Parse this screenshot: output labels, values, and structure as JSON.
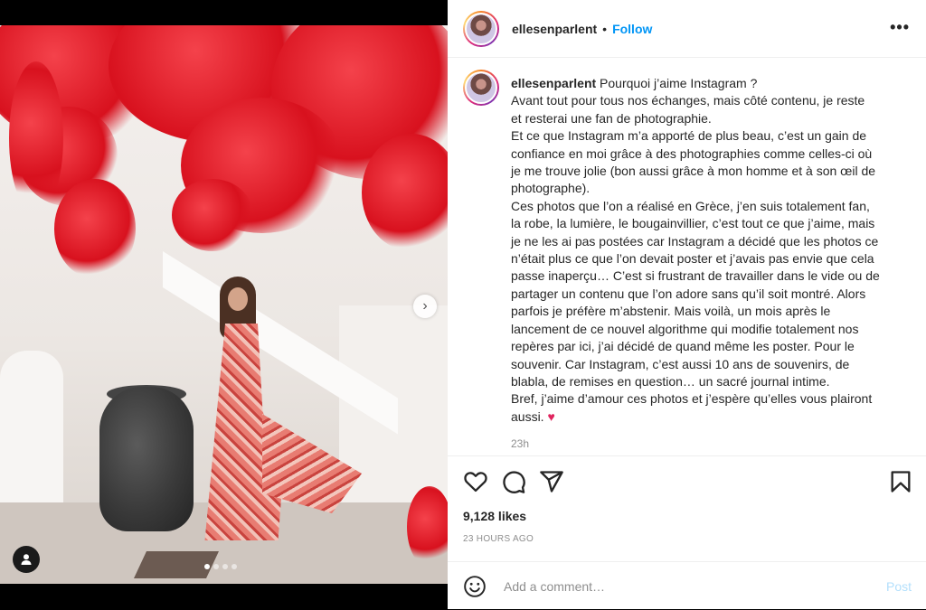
{
  "post": {
    "username": "ellesenparlent",
    "separator": "•",
    "follow_label": "Follow",
    "more_label": "•••",
    "caption_lines": [
      "Avant tout pour tous nos échanges, mais côté contenu, je reste",
      "et resterai une fan de photographie.",
      "Et ce que Instagram m’a apporté de plus beau, c’est un gain de",
      "confiance en moi grâce à des photographies comme celles-ci où",
      "je me trouve jolie (bon aussi grâce à mon homme et à son œil de",
      "photographe).",
      "Ces photos que l’on a réalisé en Grèce, j’en suis totalement fan,",
      "la robe, la lumière, le bougainvillier, c’est tout ce que j’aime, mais",
      "je ne les ai pas postées car Instagram a décidé que les photos ce",
      "n’était plus ce que l’on devait poster et j’avais pas envie que cela",
      "passe inaperçu… C’est si frustrant de travailler dans le vide ou de",
      "partager un contenu que l’on adore sans qu’il soit montré. Alors",
      "parfois je préfère m’abstenir. Mais voilà, un mois après le",
      "lancement de ce nouvel algorithme qui modifie totalement nos",
      "repères par ici, j’ai décidé de quand même les poster. Pour le",
      "souvenir. Car Instagram, c’est aussi 10 ans de souvenirs, de",
      "blabla, de remises en question… un sacré journal intime.",
      "Bref, j’aime d’amour ces photos et j’espère qu’elles vous plairont"
    ],
    "caption_first": "Pourquoi j’aime Instagram ?",
    "caption_last": "aussi.",
    "caption_emoji": "♥",
    "caption_time": "23h",
    "likes": "9,128 likes",
    "date": "23 HOURS AGO",
    "comment_placeholder": "Add a comment…",
    "post_label": "Post",
    "carousel": {
      "count": 4,
      "active_index": 0
    },
    "accent_color": "#0095f6",
    "icons": [
      "heart-icon",
      "comment-icon",
      "share-icon",
      "bookmark-icon",
      "emoji-icon",
      "user-tag-icon",
      "chevron-right-icon"
    ]
  }
}
